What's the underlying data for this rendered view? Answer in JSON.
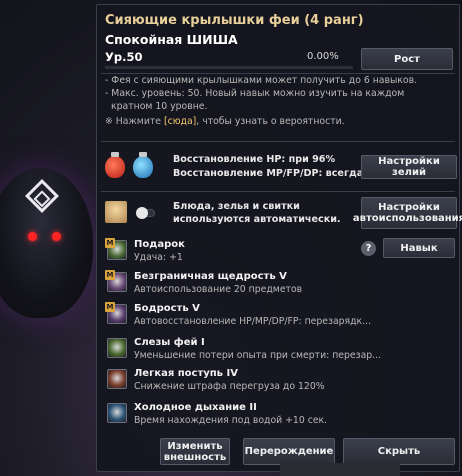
{
  "pet": {
    "title": "Сияющие крылышки феи (4 ранг)",
    "name": "Спокойная ШИША",
    "level": "Ур.50",
    "exp_percent": "0.00%",
    "exp_fraction": 0.0,
    "rebirth_label": "Рост"
  },
  "info": {
    "line1": "- Фея с сияющими крылышками может получить до 6 навыков.",
    "line2": "- Макс. уровень: 50. Новый навык можно изучить на каждом",
    "line3": "кратном 10 уровне.",
    "hint_prefix": "※ Нажмите ",
    "hint_link": "[сюда]",
    "hint_suffix": ", чтобы узнать о вероятности."
  },
  "potions": {
    "hp_text": "Восстановление HP: при 96%",
    "mp_text": "Восстановление MP/FP/DP: всегда",
    "settings_label": "Настройки зелий",
    "hp_color": "#d9342a",
    "mp_color": "#2a8fd9"
  },
  "auto_use": {
    "text_line1": "Блюда, зелья и свитки",
    "text_line2": "используются автоматически.",
    "toggle_on": false,
    "settings_label": "Настройки автоиспользования"
  },
  "skills_header": {
    "help_label": "?",
    "skill_button": "Навык"
  },
  "skills": [
    {
      "icon": "gift-clover-icon",
      "badge": "M",
      "name": "Подарок",
      "desc": "Удача: +1",
      "color": "#4a6b34"
    },
    {
      "icon": "fairy-wings-icon",
      "badge": "M",
      "name": "Безграничная щедрость V",
      "desc": "Автоиспользование 20 предметов",
      "color": "#6b4a78"
    },
    {
      "icon": "potion-vigor-icon",
      "badge": "M",
      "name": "Бодрость V",
      "desc": "Автовосстановление HP/MP/DP/FP: перезарядк...",
      "color": "#5a3d6e"
    },
    {
      "icon": "fairy-tears-icon",
      "badge": "",
      "name": "Слезы фей I",
      "desc": "Уменьшение потери опыта при смерти: перезар...",
      "color": "#4c6b2e"
    },
    {
      "icon": "light-step-icon",
      "badge": "",
      "name": "Легкая поступь IV",
      "desc": "Снижение штрафа перегруза до 120%",
      "color": "#7a3e2c"
    },
    {
      "icon": "cold-breath-icon",
      "badge": "",
      "name": "Холодное дыхание II",
      "desc": "Время нахождения под водой +10 сек.",
      "color": "#2c5578"
    }
  ],
  "footer": {
    "appearance_label": "Изменить внешность",
    "rebirth_label": "Перерождение",
    "hide_label": "Скрыть"
  }
}
